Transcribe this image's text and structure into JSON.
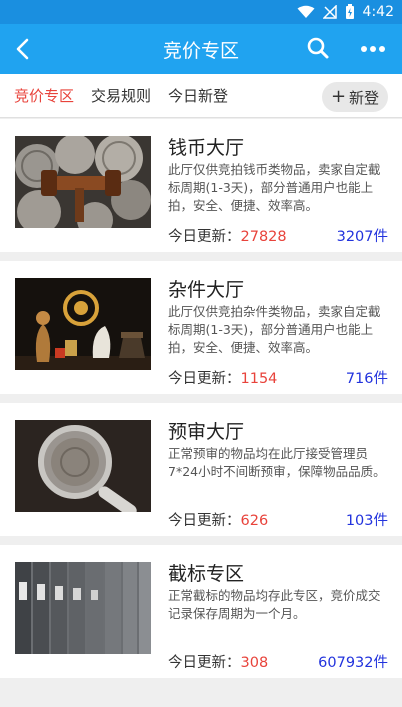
{
  "status_bar": {
    "time": "4:42"
  },
  "header": {
    "title": "竞价专区"
  },
  "tabs": [
    {
      "label": "竞价专区"
    },
    {
      "label": "交易规则"
    },
    {
      "label": "今日新登"
    }
  ],
  "new_button": {
    "label": "新登"
  },
  "halls": [
    {
      "name": "钱币大厅",
      "desc": "此厅仅供竞拍钱币类物品，卖家自定截标周期(1-3天)，部分普通用户也能上拍，安全、便捷、效率高。",
      "update_label": "今日更新：",
      "update_count": "27828",
      "total": "3207件"
    },
    {
      "name": "杂件大厅",
      "desc": "此厅仅供竞拍杂件类物品，卖家自定截标周期(1-3天)，部分普通用户也能上拍，安全、便捷、效率高。",
      "update_label": "今日更新：",
      "update_count": "1154",
      "total": "716件"
    },
    {
      "name": "预审大厅",
      "desc": "正常预审的物品均在此厅接受管理员7*24小时不间断预审，保障物品品质。",
      "update_label": "今日更新：",
      "update_count": "626",
      "total": "103件"
    },
    {
      "name": "截标专区",
      "desc": "正常截标的物品均存此专区，竞价成交记录保存周期为一个月。",
      "update_label": "今日更新：",
      "update_count": "308",
      "total": "607932件"
    }
  ],
  "colors": {
    "header_blue": "#20a3f0",
    "accent_red": "#e8433b",
    "count_blue": "#2233dd"
  }
}
